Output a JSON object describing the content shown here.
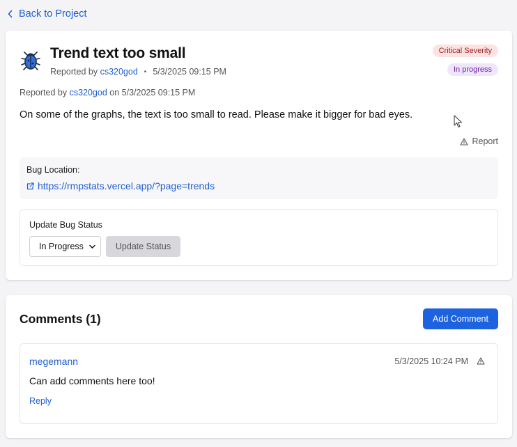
{
  "nav": {
    "back_label": "Back to Project"
  },
  "bug": {
    "title": "Trend text too small",
    "reported_prefix": "Reported by ",
    "reporter": "cs320god",
    "timestamp": "5/3/2025 09:15 PM",
    "reported_on": " on ",
    "severity_badge": "Critical Severity",
    "status_badge": "In progress",
    "description": "On some of the graphs, the text is too small to read. Please make it bigger for bad eyes.",
    "report_label": "Report",
    "location_label": "Bug Location:",
    "location_url": "https://rmpstats.vercel.app/?page=trends",
    "update": {
      "label": "Update Bug Status",
      "selected": "In Progress",
      "button": "Update Status"
    }
  },
  "comments": {
    "heading": "Comments (1)",
    "add_button": "Add Comment",
    "items": [
      {
        "author": "megemann",
        "timestamp": "5/3/2025 10:24 PM",
        "body": "Can add comments here too!",
        "reply_label": "Reply"
      }
    ]
  },
  "colors": {
    "accent": "#1f5fd0",
    "primary_button": "#1d63e0",
    "severity_bg": "#fde2e2",
    "severity_text": "#9b1c1c",
    "status_bg": "#f0e6fb",
    "status_text": "#6b21a8"
  },
  "icons": [
    "chevron-left-icon",
    "bug-icon",
    "warning-triangle-icon",
    "external-link-icon",
    "chevron-down-icon",
    "mouse-cursor-icon"
  ]
}
